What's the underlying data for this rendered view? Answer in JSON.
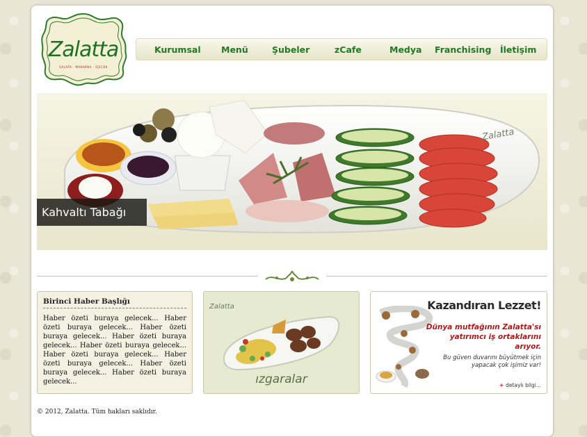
{
  "brand": {
    "logo_text": "Zalatta",
    "logo_tagline": "SALATA · MAKARNA · İÇECEK",
    "colors": {
      "green": "#1f7a23",
      "red": "#b0181a"
    }
  },
  "nav": {
    "items": [
      "Kurumsal",
      "Menü",
      "Şubeler",
      "zCafe",
      "Medya",
      "Franchising",
      "İletişim"
    ]
  },
  "hero": {
    "caption": "Kahvaltı Tabağı",
    "plate_logo": "Zalatta"
  },
  "divider": {
    "ornament": "ornament-icon"
  },
  "news": {
    "title": "Birinci Haber Başlığı",
    "body": "Haber özeti buraya gelecek... Haber özeti buraya gelecek... Haber özeti buraya gelecek... Haber özeti buraya gelecek... Haber özeti buraya gelecek... Haber özeti buraya gelecek... Haber özeti buraya gelecek... Haber özeti buraya gelecek... Haber özeti buraya gelecek..."
  },
  "grill": {
    "title": "ızgaralar",
    "logo": "Zalatta"
  },
  "promo": {
    "title": "Kazandıran Lezzet!",
    "subtitle": "Dünya mutfağının Zalatta'sı yatırımcı iş ortaklarını arıyor.",
    "subtitle2": "Bu güven duvarını büyütmek için yapacak çok işimiz var!",
    "link": "detaylı bilgi..."
  },
  "footer": {
    "copyright": "© 2012, Zalatta. Tüm hakları saklıdır."
  }
}
